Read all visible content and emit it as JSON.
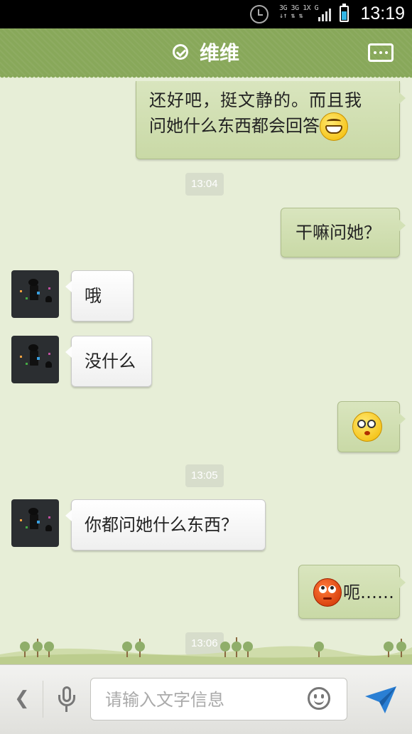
{
  "status_bar": {
    "time": "13:19",
    "network_labels": [
      "3G 3G 1X G",
      "↓↑ ⇅ ⇅"
    ],
    "icons": [
      "alarm-icon",
      "signal-icon",
      "battery-charging-icon"
    ]
  },
  "header": {
    "title": "维维",
    "icons": [
      "verified-check-icon",
      "more-options-icon"
    ],
    "color": "#88a85a"
  },
  "messages": [
    {
      "side": "right",
      "text_line1": "还好吧，挺文静的。而且我",
      "text_line2": "问她什么东西都会回答",
      "emoji": "grin-emoji"
    },
    {
      "type": "timestamp",
      "text": "13:04"
    },
    {
      "side": "right",
      "text": "干嘛问她？"
    },
    {
      "side": "left",
      "text": "哦",
      "avatar": "contact-avatar"
    },
    {
      "side": "left",
      "text": "没什么",
      "avatar": "contact-avatar"
    },
    {
      "side": "right",
      "text": "",
      "emoji": "dizzy-emoji"
    },
    {
      "type": "timestamp",
      "text": "13:05"
    },
    {
      "side": "left",
      "text": "你都问她什么东西？",
      "avatar": "contact-avatar"
    },
    {
      "side": "right",
      "text": "呃……",
      "emoji": "awkward-emoji"
    },
    {
      "type": "timestamp",
      "text": "13:06"
    }
  ],
  "input_bar": {
    "placeholder": "请输入文字信息",
    "icons": [
      "back-chevron-icon",
      "microphone-icon",
      "emoji-icon",
      "send-icon"
    ]
  },
  "colors": {
    "chat_background": "#e7eed7",
    "right_bubble": "#d3e1b6",
    "left_bubble": "#ffffff",
    "send_icon": "#2a7fd4"
  }
}
